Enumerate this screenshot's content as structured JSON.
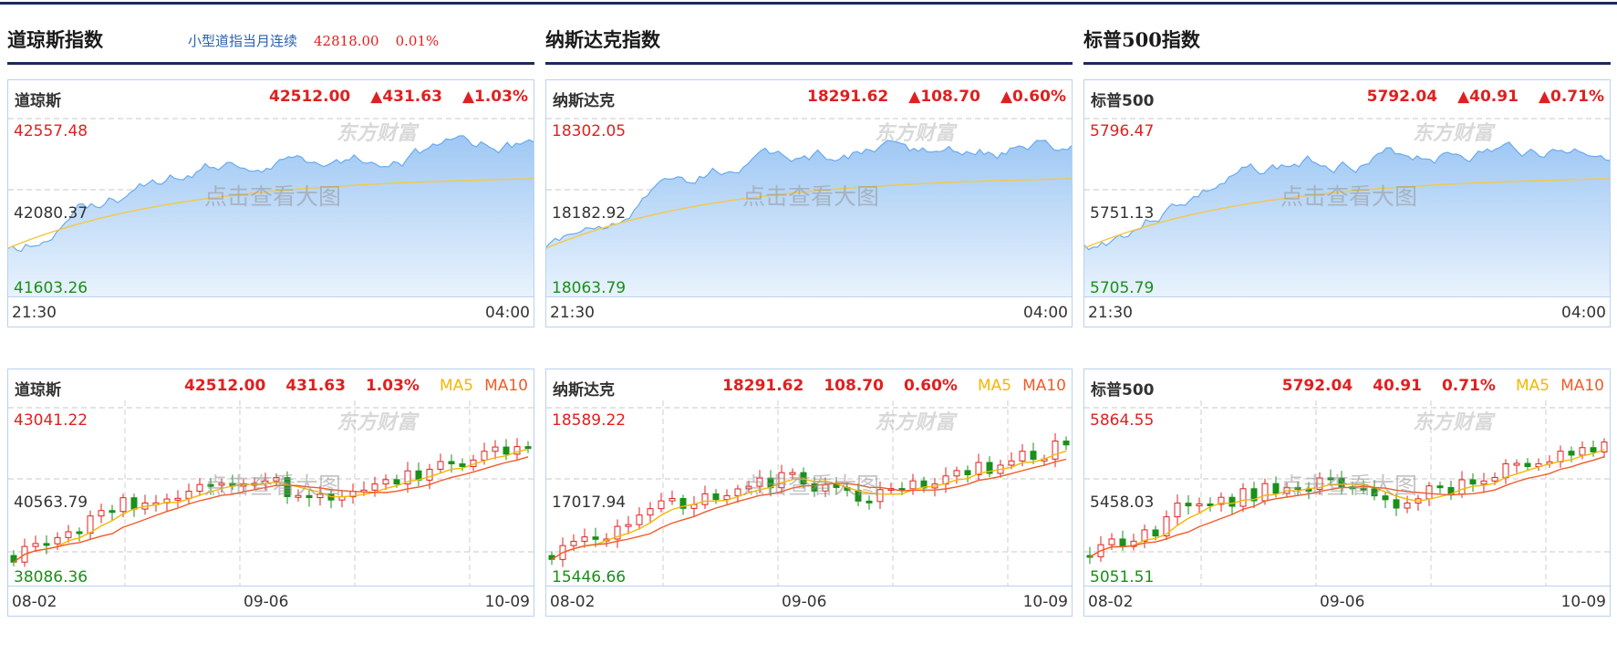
{
  "sidebar_quote": {
    "name": "小型道指当月连续",
    "price": "42818.00",
    "change_pct": "0.01%"
  },
  "watermark": "点击查看大图",
  "logo_text": "东方财富",
  "ma5_label": "MA5",
  "ma10_label": "MA10",
  "columns": [
    {
      "title": "道琼斯指数",
      "intraday": {
        "name": "道琼斯",
        "price": "42512.00",
        "change": "▲431.63",
        "change_pct": "▲1.03%",
        "y_high": "42557.48",
        "y_mid": "42080.37",
        "y_low": "41603.26",
        "x_start": "21:30",
        "x_end": "04:00"
      },
      "daily": {
        "name": "道琼斯",
        "price": "42512.00",
        "change": "431.63",
        "change_pct": "1.03%",
        "y_high": "43041.22",
        "y_mid": "40563.79",
        "y_low": "38086.36",
        "x_start": "08-02",
        "x_mid": "09-06",
        "x_end": "10-09"
      }
    },
    {
      "title": "纳斯达克指数",
      "intraday": {
        "name": "纳斯达克",
        "price": "18291.62",
        "change": "▲108.70",
        "change_pct": "▲0.60%",
        "y_high": "18302.05",
        "y_mid": "18182.92",
        "y_low": "18063.79",
        "x_start": "21:30",
        "x_end": "04:00"
      },
      "daily": {
        "name": "纳斯达克",
        "price": "18291.62",
        "change": "108.70",
        "change_pct": "0.60%",
        "y_high": "18589.22",
        "y_mid": "17017.94",
        "y_low": "15446.66",
        "x_start": "08-02",
        "x_mid": "09-06",
        "x_end": "10-09"
      }
    },
    {
      "title": "标普500指数",
      "intraday": {
        "name": "标普500",
        "price": "5792.04",
        "change": "▲40.91",
        "change_pct": "▲0.71%",
        "y_high": "5796.47",
        "y_mid": "5751.13",
        "y_low": "5705.79",
        "x_start": "21:30",
        "x_end": "04:00"
      },
      "daily": {
        "name": "标普500",
        "price": "5792.04",
        "change": "40.91",
        "change_pct": "0.71%",
        "y_high": "5864.55",
        "y_mid": "5458.03",
        "y_low": "5051.51",
        "x_start": "08-02",
        "x_mid": "09-06",
        "x_end": "10-09"
      }
    }
  ],
  "colors": {
    "up": "#e02020",
    "down": "#1a8f1a",
    "ma5": "#f5b700",
    "ma10": "#f05b2a",
    "area_line": "#6aaaf0",
    "area_fill": "#b8d8f8",
    "avg": "#f2c94c"
  }
}
